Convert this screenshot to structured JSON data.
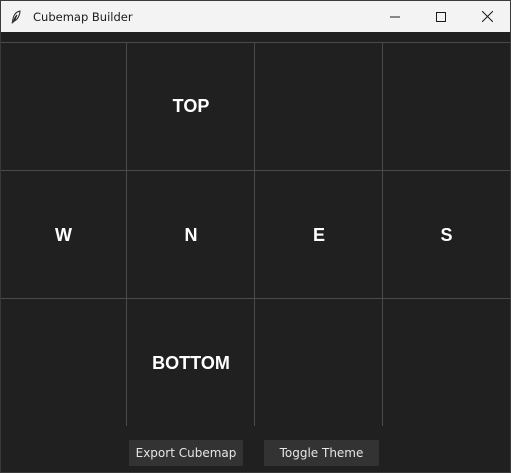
{
  "window": {
    "title": "Cubemap Builder",
    "app_icon": "feather-icon",
    "controls": [
      "minimize-icon",
      "maximize-icon",
      "close-icon"
    ]
  },
  "grid": {
    "cells": {
      "top": "TOP",
      "west": "W",
      "north": "N",
      "east": "E",
      "south": "S",
      "bottom": "BOTTOM"
    }
  },
  "buttons": {
    "export_label": "Export Cubemap",
    "toggle_label": "Toggle Theme"
  },
  "colors": {
    "background": "#202020",
    "grid_line": "#4a4a4a",
    "button_bg": "#333333",
    "titlebar_bg": "#f3f3f3",
    "text": "#ffffff"
  }
}
